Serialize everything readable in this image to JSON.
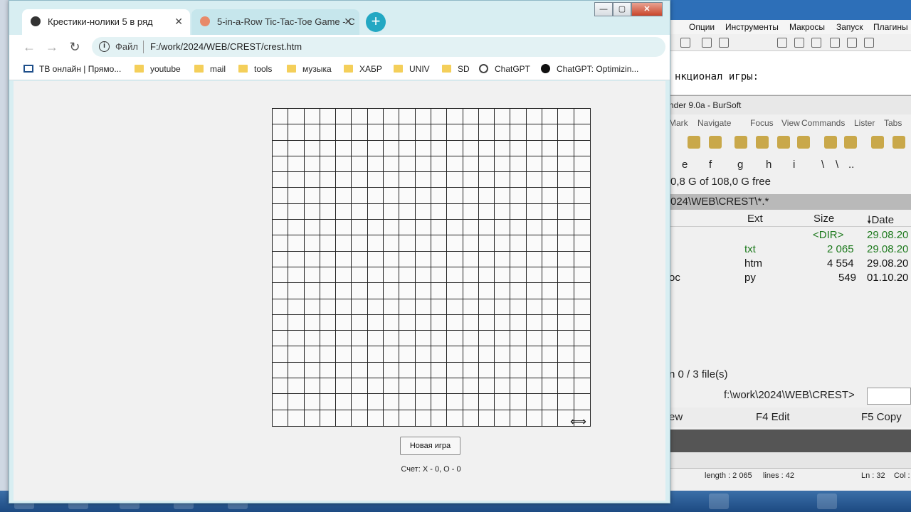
{
  "browser": {
    "tabs": [
      {
        "label": "Крестики-нолики 5 в ряд",
        "active": true
      },
      {
        "label": "5-in-a-Row Tic-Tac-Toe Game - C",
        "active": false
      }
    ],
    "address": {
      "scheme_label": "Файл",
      "url": "F:/work/2024/WEB/CREST/crest.htm"
    },
    "bookmarks": [
      {
        "label": "ТВ онлайн | Прямо...",
        "icon": "monitor-icon"
      },
      {
        "label": "youtube",
        "icon": "folder-icon"
      },
      {
        "label": "mail",
        "icon": "folder-icon"
      },
      {
        "label": "tools",
        "icon": "folder-icon"
      },
      {
        "label": "музыка",
        "icon": "folder-icon"
      },
      {
        "label": "ХАБР",
        "icon": "folder-icon"
      },
      {
        "label": "UNIV",
        "icon": "folder-icon"
      },
      {
        "label": "SD",
        "icon": "folder-icon"
      },
      {
        "label": "ChatGPT",
        "icon": "chatgpt-icon"
      },
      {
        "label": "ChatGPT: Optimizin...",
        "icon": "chatgpt-icon"
      }
    ]
  },
  "game": {
    "grid_size": 20,
    "new_game_label": "Новая игра",
    "score_text": "Счет: X - 0, O - 0"
  },
  "notepad": {
    "menu": [
      "Опции",
      "Инструменты",
      "Макросы",
      "Запуск",
      "Плагины"
    ],
    "editor_line": "нкционал игры:",
    "status": {
      "length": "length : 2 065",
      "lines": "lines : 42",
      "ln": "Ln : 32",
      "col": "Col :"
    }
  },
  "total_commander": {
    "title": "nder 9.0a - BurSoft",
    "menu": [
      "Mark",
      "Navigate",
      "Focus",
      "View",
      "Commands",
      "Lister",
      "Tabs"
    ],
    "drives": [
      "e",
      "f",
      "g",
      "h",
      "i",
      "\\",
      "\\",
      ".."
    ],
    "free_space": "0,8 G of 108,0 G free",
    "path": "024\\WEB\\CREST\\*.*",
    "columns": {
      "ext": "Ext",
      "size": "Size",
      "date": "Date"
    },
    "rows": [
      {
        "name": "",
        "ext": "",
        "size": "<DIR>",
        "date": "29.08.20",
        "color": "#1e7a1e"
      },
      {
        "name": "",
        "ext": "txt",
        "size": "2 065",
        "date": "29.08.20",
        "color": "#1e7a1e"
      },
      {
        "name": "",
        "ext": "htm",
        "size": "4 554",
        "date": "29.08.20",
        "color": "#111111"
      },
      {
        "name": "oc",
        "ext": "py",
        "size": "549",
        "date": "01.10.20",
        "color": "#111111"
      }
    ],
    "files_summary": "n 0 / 3 file(s)",
    "cmd_prompt": "f:\\work\\2024\\WEB\\CREST>",
    "fkeys": [
      "ew",
      "F4 Edit",
      "F5 Copy"
    ]
  },
  "window_controls": {
    "minimize": "—",
    "restore": "▢",
    "close": "✕"
  }
}
